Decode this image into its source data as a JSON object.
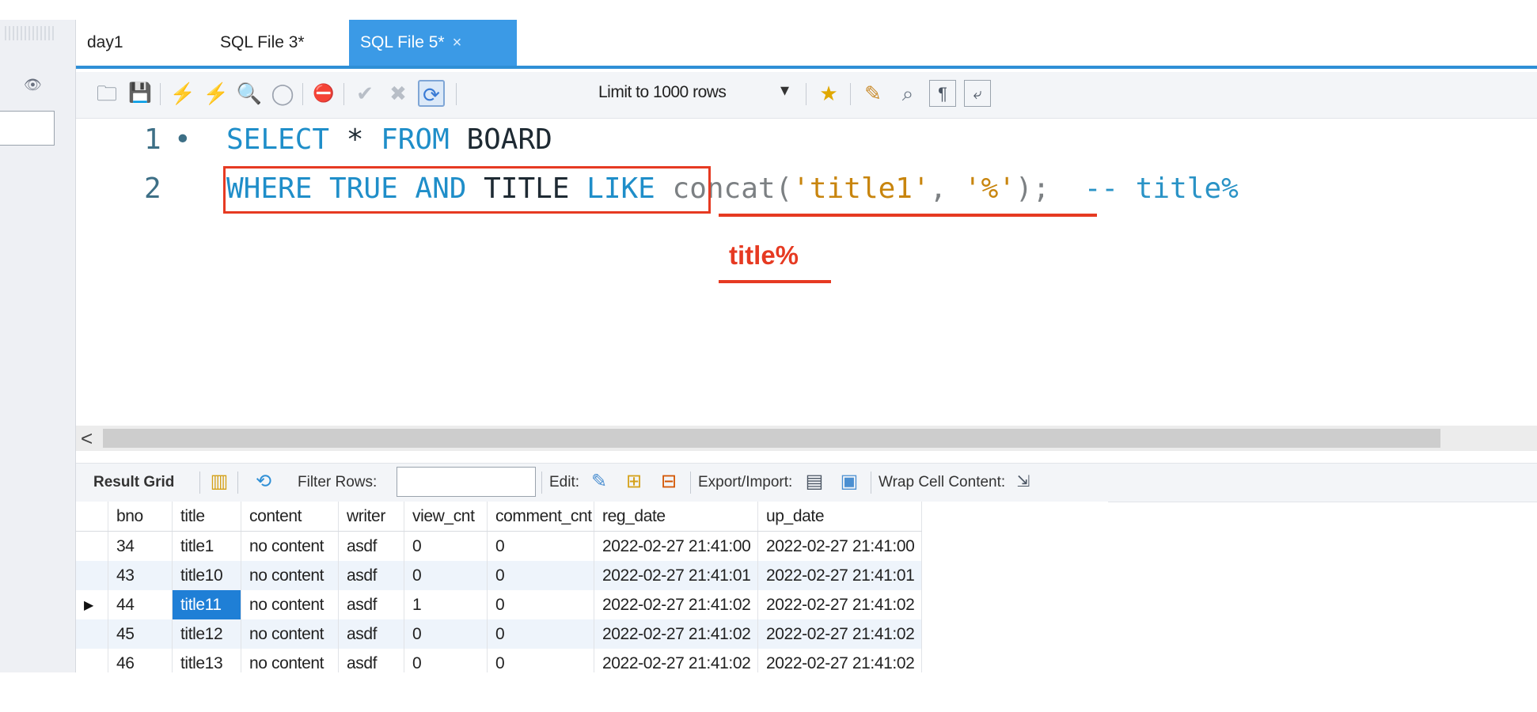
{
  "tabs": [
    {
      "label": "day1"
    },
    {
      "label": "SQL File 3*"
    },
    {
      "label": "SQL File 5*",
      "close": "×"
    }
  ],
  "toolbar": {
    "limit_label": "Limit to 1000 rows",
    "limit_caret": "▾",
    "icons": [
      "folder-icon",
      "save-icon",
      "execute-icon",
      "execute-current-icon",
      "explain-icon",
      "stop-icon",
      "toggle-error-icon",
      "commit-icon",
      "rollback-icon",
      "autocommit-icon",
      "beautify-icon",
      "find-icon",
      "invisibles-icon",
      "wrap-icon",
      "favorite-icon"
    ]
  },
  "editor": {
    "lines": [
      {
        "number": "1",
        "marker": "•",
        "tokens": [
          {
            "t": "SELECT",
            "c": "kw"
          },
          {
            "t": " * ",
            "c": "plain"
          },
          {
            "t": "FROM",
            "c": "kw"
          },
          {
            "t": " BOARD",
            "c": "plain"
          }
        ]
      },
      {
        "number": "2",
        "marker": "",
        "tokens": [
          {
            "t": "WHERE TRUE AND",
            "c": "kw"
          },
          {
            "t": " TITLE ",
            "c": "plain"
          },
          {
            "t": "LIKE",
            "c": "kw"
          },
          {
            "t": " concat(",
            "c": "fn"
          },
          {
            "t": "'title1'",
            "c": "str"
          },
          {
            "t": ", ",
            "c": "fn"
          },
          {
            "t": "'%'",
            "c": "str"
          },
          {
            "t": ");",
            "c": "fn"
          },
          {
            "t": "  -- title%",
            "c": "cm"
          }
        ]
      }
    ]
  },
  "annotation": {
    "text": "title%",
    "color": "#e63a22"
  },
  "scroll": {
    "left_arrow": "<"
  },
  "result_toolbar": {
    "result_grid": "Result Grid",
    "filter_rows": "Filter Rows:",
    "filter_value": "",
    "edit": "Edit:",
    "export_import": "Export/Import:",
    "wrap_cell": "Wrap Cell Content:"
  },
  "grid": {
    "columns": [
      "bno",
      "title",
      "content",
      "writer",
      "view_cnt",
      "comment_cnt",
      "reg_date",
      "up_date"
    ],
    "selected_row": 2,
    "selected_col": 1,
    "row_pointer": "▶",
    "rows": [
      [
        "34",
        "title1",
        "no content",
        "asdf",
        "0",
        "0",
        "2022-02-27 21:41:00",
        "2022-02-27 21:41:00"
      ],
      [
        "43",
        "title10",
        "no content",
        "asdf",
        "0",
        "0",
        "2022-02-27 21:41:01",
        "2022-02-27 21:41:01"
      ],
      [
        "44",
        "title11",
        "no content",
        "asdf",
        "1",
        "0",
        "2022-02-27 21:41:02",
        "2022-02-27 21:41:02"
      ],
      [
        "45",
        "title12",
        "no content",
        "asdf",
        "0",
        "0",
        "2022-02-27 21:41:02",
        "2022-02-27 21:41:02"
      ],
      [
        "46",
        "title13",
        "no content",
        "asdf",
        "0",
        "0",
        "2022-02-27 21:41:02",
        "2022-02-27 21:41:02"
      ]
    ]
  }
}
